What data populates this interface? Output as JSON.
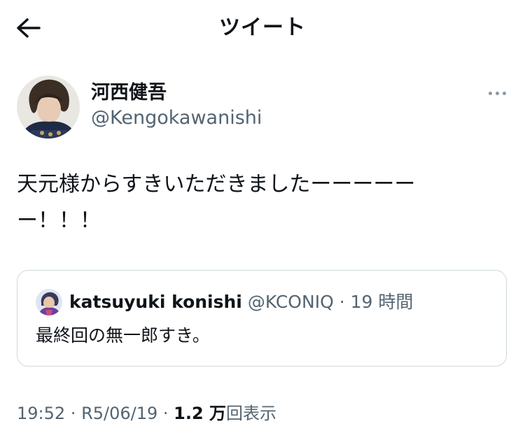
{
  "header": {
    "title": "ツイート"
  },
  "tweet": {
    "author_name": "河西健吾",
    "author_handle": "@Kengokawanishi",
    "text": "天元様からすきいただきましたーーーーーー！！！"
  },
  "quote": {
    "author_name": "katsuyuki konishi",
    "author_handle": "@KCONIQ",
    "separator": " · ",
    "time": "19 時間",
    "text": "最終回の無一郎すき。"
  },
  "meta": {
    "time": "19:52",
    "sep1": " · ",
    "date": "R5/06/19",
    "sep2": " · ",
    "views_count": "1.2 万",
    "views_label": "回表示"
  },
  "colors": {
    "text_primary": "#0f1419",
    "text_secondary": "#536471",
    "border": "#cfd9de"
  },
  "icons": {
    "back": "arrow-left-icon",
    "more": "more-dots-icon"
  }
}
